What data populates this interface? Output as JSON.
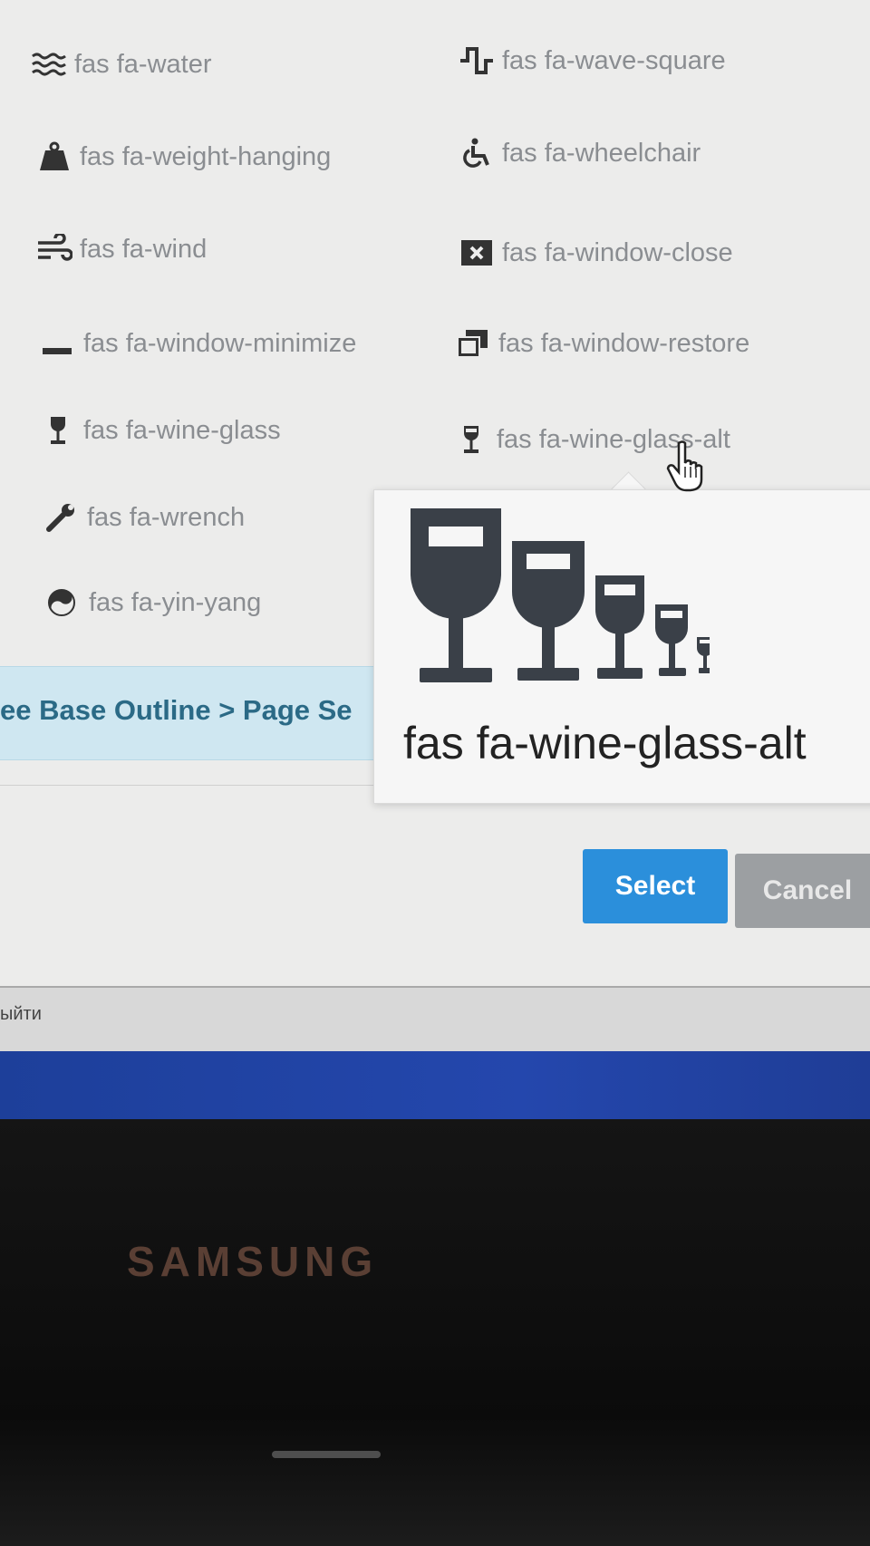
{
  "icons": [
    {
      "label": "fas fa-water",
      "icon": "water-icon"
    },
    {
      "label": "fas fa-wave-square",
      "icon": "wave-square-icon"
    },
    {
      "label": "fas fa-weight-hanging",
      "icon": "weight-hanging-icon"
    },
    {
      "label": "fas fa-wheelchair",
      "icon": "wheelchair-icon"
    },
    {
      "label": "fas fa-wind",
      "icon": "wind-icon"
    },
    {
      "label": "fas fa-window-close",
      "icon": "window-close-icon"
    },
    {
      "label": "fas fa-window-minimize",
      "icon": "window-minimize-icon"
    },
    {
      "label": "fas fa-window-restore",
      "icon": "window-restore-icon"
    },
    {
      "label": "fas fa-wine-glass",
      "icon": "wine-glass-icon"
    },
    {
      "label": "fas fa-wine-glass-alt",
      "icon": "wine-glass-alt-icon"
    },
    {
      "label": "fas fa-wrench",
      "icon": "wrench-icon"
    },
    {
      "label": "fas fa-yin-yang",
      "icon": "yin-yang-icon"
    }
  ],
  "breadcrumb": "ee Base Outline > Page Se",
  "preview": {
    "name": "fas fa-wine-glass-alt",
    "icon": "wine-glass-alt-icon"
  },
  "buttons": {
    "select": "Select",
    "cancel": "Cancel"
  },
  "taskbar": {
    "text": "ыйти"
  },
  "monitor": {
    "brand": "SAMSUNG"
  },
  "colors": {
    "primary": "#2b8fdb",
    "cancel": "#9c9fa2",
    "icon_text": "#8a8d91",
    "breadcrumb_bg": "#cfe7f1",
    "taskbar_blue": "#2447ad"
  }
}
